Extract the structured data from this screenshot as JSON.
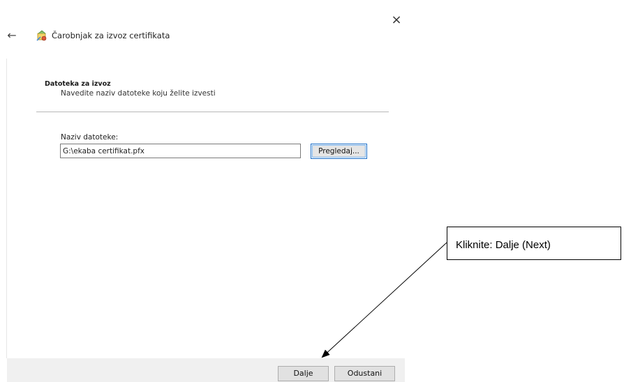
{
  "window": {
    "close_glyph": "×",
    "back_glyph": "←"
  },
  "wizard": {
    "title": "Čarobnjak za izvoz certifikata",
    "icon": "certificate-wizard-icon"
  },
  "section": {
    "heading": "Datoteka za izvoz",
    "subtitle": "Navedite naziv datoteke koju želite izvesti"
  },
  "file": {
    "label": "Naziv datoteke:",
    "value": "G:\\ekaba certifikat.pfx",
    "browse_label": "Pregledaj..."
  },
  "footer": {
    "next_label": "Dalje",
    "cancel_label": "Odustani"
  },
  "annotation": {
    "text": "Kliknite: Dalje (Next)"
  },
  "colors": {
    "footer_bg": "#f0f0f0",
    "focus_border": "#1a6ec8"
  }
}
